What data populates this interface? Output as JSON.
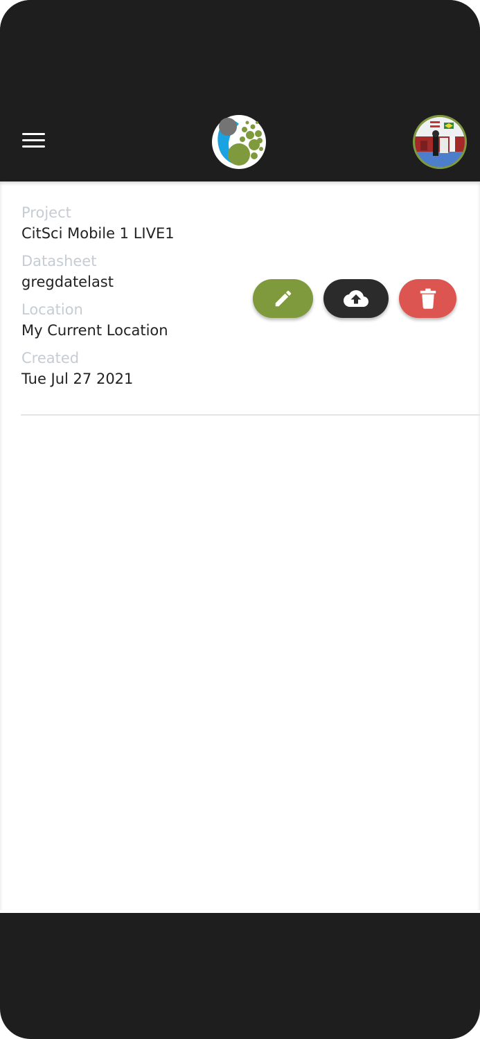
{
  "header": {
    "menu_icon": "hamburger-menu-icon",
    "logo_icon": "citsci-logo",
    "avatar_icon": "user-avatar-photo"
  },
  "record": {
    "project_label": "Project",
    "project_value": "CitSci Mobile 1 LIVE1",
    "datasheet_label": "Datasheet",
    "datasheet_value": "gregdatelast",
    "location_label": "Location",
    "location_value": "My Current Location",
    "created_label": "Created",
    "created_value": "Tue Jul 27 2021"
  },
  "actions": {
    "edit_icon": "pencil-icon",
    "upload_icon": "cloud-upload-icon",
    "delete_icon": "trash-icon"
  },
  "colors": {
    "appbar": "#1e1e1e",
    "edit": "#7e9a3c",
    "upload": "#2b2b2b",
    "delete": "#dc5551",
    "label": "#c6ccd3",
    "value": "#222222"
  }
}
